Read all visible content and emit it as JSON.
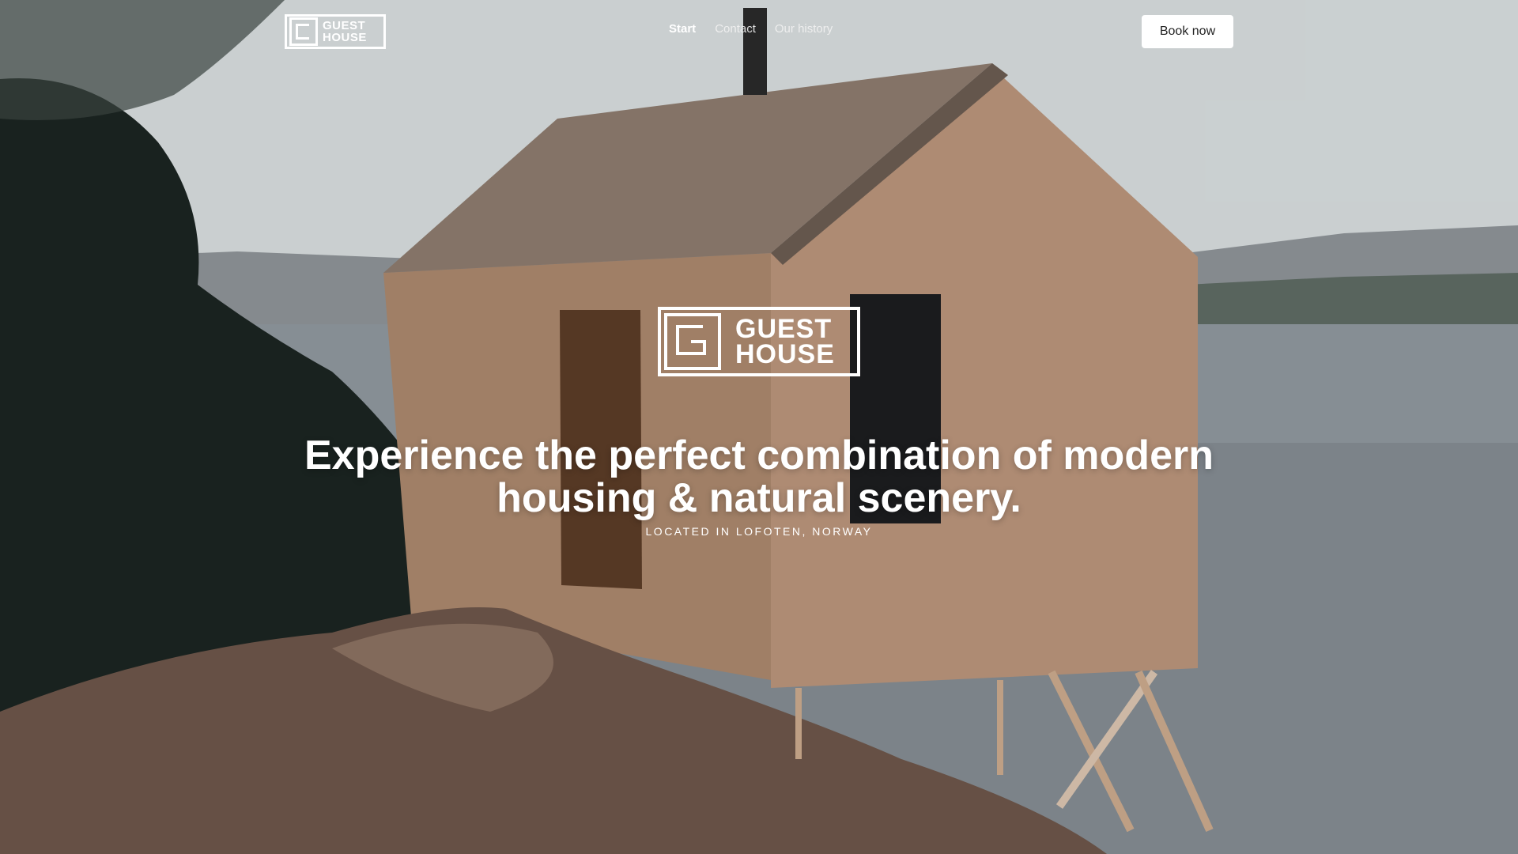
{
  "brand": {
    "line1": "GUEST",
    "line2": "HOUSE"
  },
  "nav": {
    "items": [
      {
        "label": "Start",
        "active": true
      },
      {
        "label": "Contact",
        "active": false
      },
      {
        "label": "Our history",
        "active": false
      }
    ],
    "cta_label": "Book now"
  },
  "hero": {
    "headline": "Experience the perfect combination of modern housing & natural scenery.",
    "location": "LOCATED IN LOFOTEN, NORWAY"
  },
  "colors": {
    "text": "#ffffff",
    "button_bg": "#ffffff",
    "button_text": "#222222"
  }
}
